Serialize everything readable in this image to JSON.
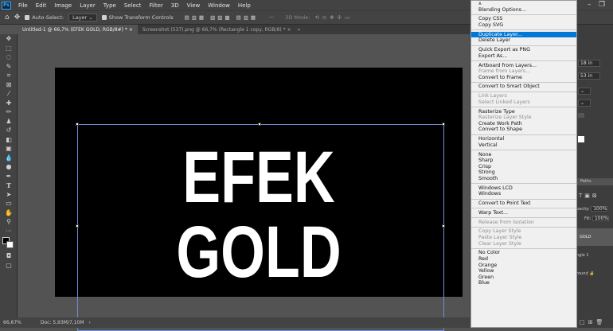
{
  "menubar": {
    "logo": "Ps",
    "items": [
      "File",
      "Edit",
      "Image",
      "Layer",
      "Type",
      "Select",
      "Filter",
      "3D",
      "View",
      "Window",
      "Help"
    ]
  },
  "options": {
    "auto_select_label": "Auto-Select:",
    "auto_select_value": "Layer",
    "transform_label": "Show Transform Controls",
    "mode_label": "3D Mode:"
  },
  "tabs": [
    {
      "label": "Untitled-1 @ 66,7% (EFEK  GOLD, RGB/8#) *"
    },
    {
      "label": "Screenshot (537).png @ 66,7% (Rectangle 1 copy, RGB/8) *"
    }
  ],
  "document": {
    "line1": "EFEK",
    "line2": "GOLD"
  },
  "status": {
    "zoom": "66,67%",
    "doc": "Doc: 5,93M/7,10M"
  },
  "panel": {
    "width": "18 in",
    "height": "53 in",
    "paths_tab": "Paths",
    "opacity_label": "pacity:",
    "opacity_value": "100%",
    "fill_label": "Fill:",
    "fill_value": "100%",
    "layer_gold": "GOLD",
    "layer_rect": "ngle 1",
    "layer_bg": "round"
  },
  "context_menu": {
    "items": [
      {
        "label": "Blending Options...",
        "state": "normal"
      },
      {
        "sep": true
      },
      {
        "label": "Copy CSS",
        "state": "normal"
      },
      {
        "label": "Copy SVG",
        "state": "normal"
      },
      {
        "sep": true
      },
      {
        "label": "Duplicate Layer...",
        "state": "highlight"
      },
      {
        "label": "Delete Layer",
        "state": "normal"
      },
      {
        "sep": true
      },
      {
        "label": "Quick Export as PNG",
        "state": "normal"
      },
      {
        "label": "Export As...",
        "state": "normal"
      },
      {
        "sep": true
      },
      {
        "label": "Artboard from Layers...",
        "state": "normal"
      },
      {
        "label": "Frame from Layers...",
        "state": "disabled"
      },
      {
        "label": "Convert to Frame",
        "state": "normal"
      },
      {
        "sep": true
      },
      {
        "label": "Convert to Smart Object",
        "state": "normal"
      },
      {
        "sep": true
      },
      {
        "label": "Link Layers",
        "state": "disabled"
      },
      {
        "label": "Select Linked Layers",
        "state": "disabled"
      },
      {
        "sep": true
      },
      {
        "label": "Rasterize Type",
        "state": "normal"
      },
      {
        "label": "Rasterize Layer Style",
        "state": "disabled"
      },
      {
        "label": "Create Work Path",
        "state": "normal"
      },
      {
        "label": "Convert to Shape",
        "state": "normal"
      },
      {
        "sep": true
      },
      {
        "label": "Horizontal",
        "state": "normal"
      },
      {
        "label": "Vertical",
        "state": "normal"
      },
      {
        "sep": true
      },
      {
        "label": "None",
        "state": "normal"
      },
      {
        "label": "Sharp",
        "state": "normal"
      },
      {
        "label": "Crisp",
        "state": "normal"
      },
      {
        "label": "Strong",
        "state": "normal"
      },
      {
        "label": "Smooth",
        "state": "normal"
      },
      {
        "sep": true
      },
      {
        "label": "Windows LCD",
        "state": "normal"
      },
      {
        "label": "Windows",
        "state": "normal"
      },
      {
        "sep": true
      },
      {
        "label": "Convert to Point Text",
        "state": "normal"
      },
      {
        "sep": true
      },
      {
        "label": "Warp Text...",
        "state": "normal"
      },
      {
        "sep": true
      },
      {
        "label": "Release from Isolation",
        "state": "disabled"
      },
      {
        "sep": true
      },
      {
        "label": "Copy Layer Style",
        "state": "disabled"
      },
      {
        "label": "Paste Layer Style",
        "state": "disabled"
      },
      {
        "label": "Clear Layer Style",
        "state": "disabled"
      },
      {
        "sep": true
      },
      {
        "label": "No Color",
        "state": "normal"
      },
      {
        "label": "Red",
        "state": "normal"
      },
      {
        "label": "Orange",
        "state": "normal"
      },
      {
        "label": "Yellow",
        "state": "normal"
      },
      {
        "label": "Green",
        "state": "normal"
      },
      {
        "label": "Blue",
        "state": "normal"
      }
    ]
  }
}
